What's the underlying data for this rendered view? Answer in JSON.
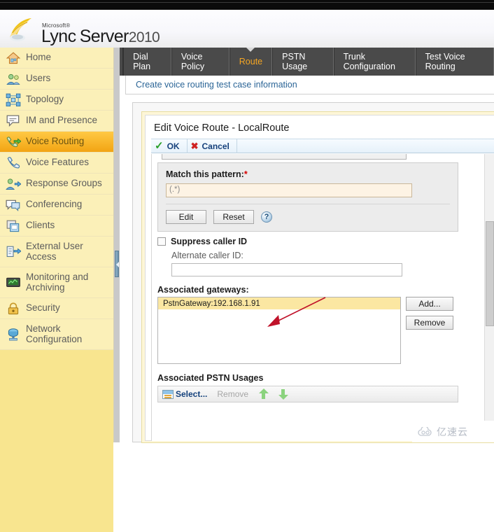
{
  "brand": {
    "microsoft": "Microsoft®",
    "product": "Lync",
    "product2": "Server",
    "year": "2010"
  },
  "sidebar": {
    "items": [
      {
        "label": "Home",
        "icon": "home-icon",
        "active": false
      },
      {
        "label": "Users",
        "icon": "users-icon",
        "active": false
      },
      {
        "label": "Topology",
        "icon": "topology-icon",
        "active": false
      },
      {
        "label": "IM and Presence",
        "icon": "chat-icon",
        "active": false
      },
      {
        "label": "Voice Routing",
        "icon": "voice-routing-icon",
        "active": true
      },
      {
        "label": "Voice Features",
        "icon": "phone-icon",
        "active": false
      },
      {
        "label": "Response Groups",
        "icon": "response-group-icon",
        "active": false
      },
      {
        "label": "Conferencing",
        "icon": "conferencing-icon",
        "active": false
      },
      {
        "label": "Clients",
        "icon": "clients-icon",
        "active": false
      },
      {
        "label": "External User Access",
        "icon": "external-user-icon",
        "active": false
      },
      {
        "label": "Monitoring and Archiving",
        "icon": "monitoring-icon",
        "active": false
      },
      {
        "label": "Security",
        "icon": "lock-icon",
        "active": false
      },
      {
        "label": "Network Configuration",
        "icon": "network-icon",
        "active": false
      }
    ]
  },
  "tabs": [
    {
      "label": "Dial Plan",
      "selected": false
    },
    {
      "label": "Voice Policy",
      "selected": false
    },
    {
      "label": "Route",
      "selected": true
    },
    {
      "label": "PSTN Usage",
      "selected": false
    },
    {
      "label": "Trunk Configuration",
      "selected": false
    },
    {
      "label": "Test Voice Routing",
      "selected": false
    }
  ],
  "breadcrumb": {
    "text": "Create voice routing test case information"
  },
  "dialog": {
    "title": "Edit Voice Route - LocalRoute",
    "toolbar": {
      "ok_label": "OK",
      "cancel_label": "Cancel"
    },
    "pattern": {
      "label": "Match this pattern:",
      "required_marker": "*",
      "value": "(.*)",
      "edit_label": "Edit",
      "reset_label": "Reset",
      "help_label": "?"
    },
    "suppress_caller_id": {
      "label": "Suppress caller ID",
      "checked": false
    },
    "alternate_caller_id": {
      "label": "Alternate caller ID:",
      "value": ""
    },
    "gateways": {
      "label": "Associated gateways:",
      "items": [
        "PstnGateway:192.168.1.91"
      ],
      "add_label": "Add...",
      "remove_label": "Remove"
    },
    "pstn_usages": {
      "label": "Associated PSTN Usages",
      "select_label": "Select...",
      "remove_label": "Remove",
      "move_up_icon": "arrow-up-icon",
      "move_down_icon": "arrow-down-icon"
    }
  },
  "watermark": {
    "text": "亿速云",
    "icon": "cloud-icon"
  },
  "colors": {
    "accent_orange": "#f5a623",
    "sidebar_yellow": "#f8e58f",
    "selected_row": "#fbe7a2",
    "tabbar_dark": "#4a4a4a",
    "link_blue": "#2a6496",
    "annotation_red": "#c0122a"
  }
}
